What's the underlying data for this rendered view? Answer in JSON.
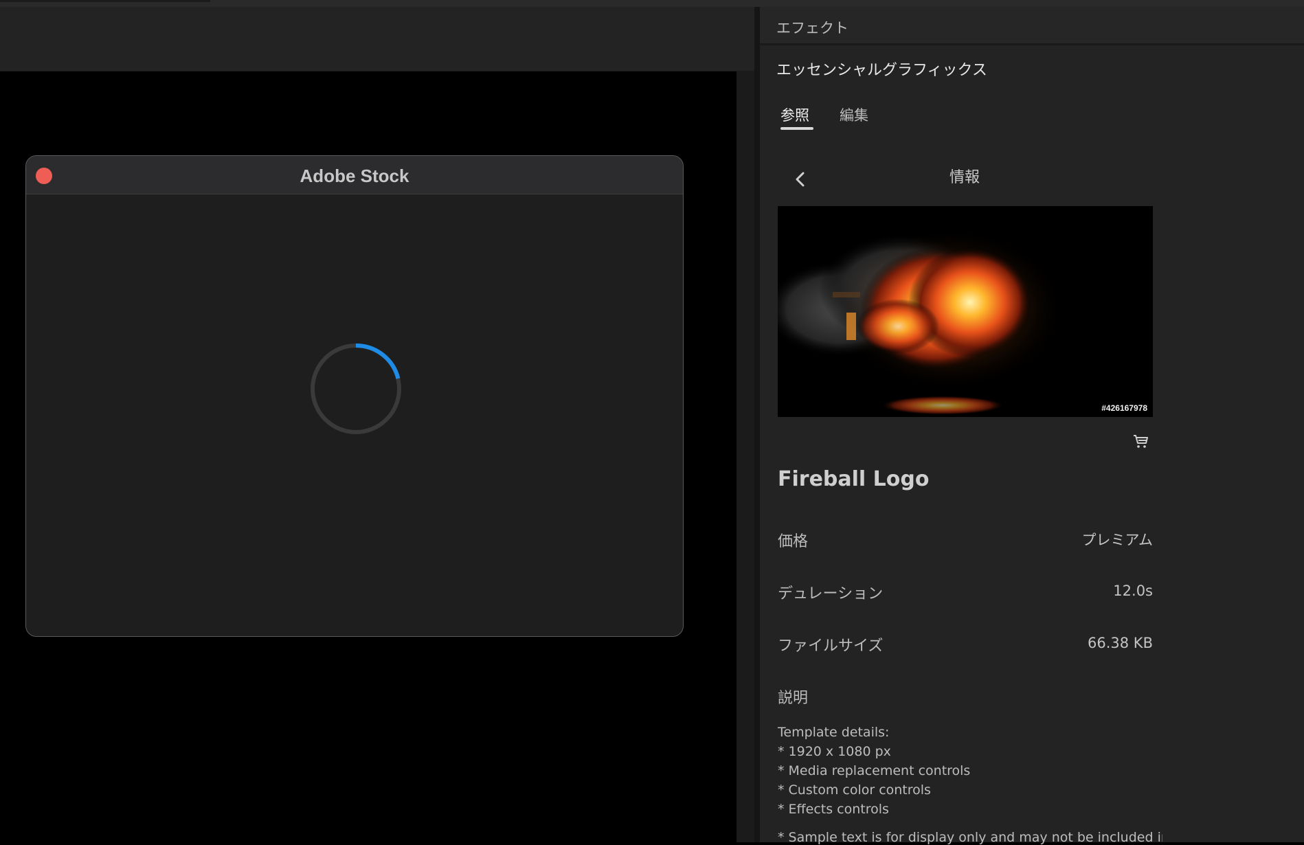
{
  "dialog": {
    "title": "Adobe Stock",
    "colors": {
      "close": "#ee5e56",
      "spinner_accent": "#1e8ce6"
    }
  },
  "panel": {
    "header_title": "エフェクト",
    "section_title": "エッセンシャルグラフィックス",
    "tabs": [
      {
        "label": "参照",
        "active": true
      },
      {
        "label": "編集",
        "active": false
      }
    ],
    "info_title": "情報",
    "back_icon": "chevron-left-icon",
    "cart_icon": "cart-icon",
    "asset": {
      "stock_id": "#426167978",
      "name": "Fireball Logo",
      "rows": [
        {
          "label": "価格",
          "value": "プレミアム"
        },
        {
          "label": "デュレーション",
          "value": "12.0s"
        },
        {
          "label": "ファイルサイズ",
          "value": "66.38 KB"
        }
      ],
      "description_label": "説明",
      "description_lines": [
        "Template details:",
        "* 1920 x 1080 px",
        "* Media replacement controls",
        "* Custom color controls",
        "* Effects controls"
      ],
      "description_note": "* Sample text is for display only and may not be included in"
    }
  }
}
